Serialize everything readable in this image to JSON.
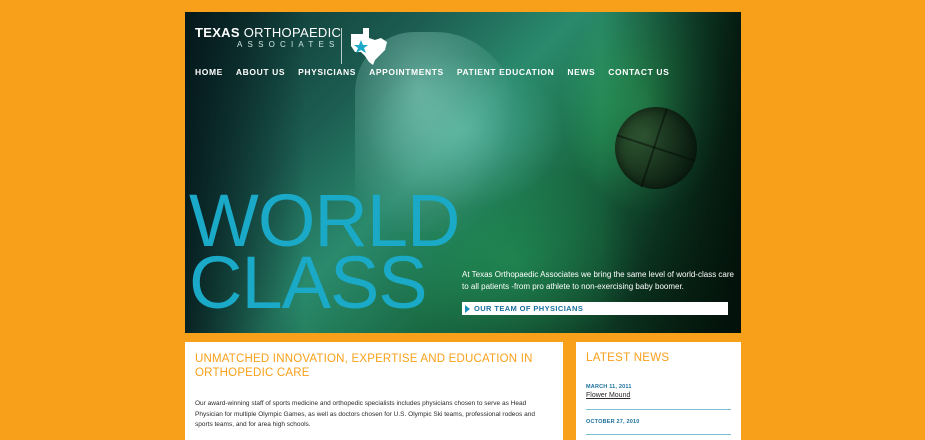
{
  "brand": {
    "name_bold": "TEXAS",
    "name_light": "ORTHOPAEDIC",
    "sub": "ASSOCIATES",
    "colors": {
      "orange": "#F8A019",
      "teal": "#1aa9c7",
      "link_blue": "#1a6f9c"
    }
  },
  "nav": [
    {
      "label": "HOME"
    },
    {
      "label": "ABOUT US"
    },
    {
      "label": "PHYSICIANS"
    },
    {
      "label": "APPOINTMENTS"
    },
    {
      "label": "PATIENT EDUCATION"
    },
    {
      "label": "NEWS"
    },
    {
      "label": "CONTACT US"
    }
  ],
  "hero": {
    "title_line1": "WORLD",
    "title_line2": "CLASS",
    "copy": "At Texas Orthopaedic Associates we bring the same level of world-class care to all patients -from pro athlete to non-exercising baby boomer.",
    "cta_label": "OUR TEAM OF PHYSICIANS"
  },
  "intro": {
    "heading": "UNMATCHED INNOVATION, EXPERTISE AND EDUCATION IN ORTHOPEDIC CARE",
    "body": "Our award-winning staff of sports medicine and orthopedic specialists includes physicians chosen to serve as Head Physician for multiple Olympic Games, as well as doctors chosen for U.S. Olympic Ski teams, professional rodeos and sports teams, and for area high schools."
  },
  "news": {
    "heading": "LATEST NEWS",
    "items": [
      {
        "date": "MARCH 11, 2011",
        "title": "Flower Mound"
      },
      {
        "date": "OCTOBER 27, 2010",
        "title": ""
      }
    ]
  }
}
